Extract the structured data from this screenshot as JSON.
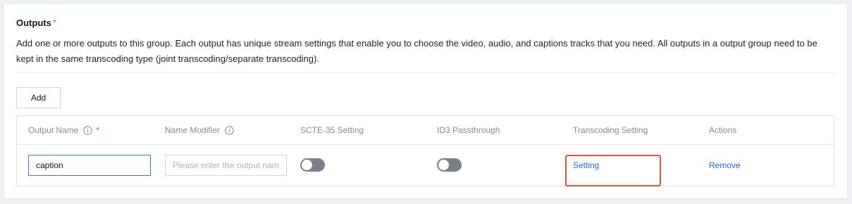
{
  "outputs": {
    "title": "Outputs",
    "required_marker": "*",
    "description": "Add one or more outputs to this group. Each output has unique stream settings that enable you to choose the video, audio, and captions tracks that you need. All outputs in a output group need to be kept in the same transcoding type (joint transcoding/separate transcoding).",
    "add_label": "Add"
  },
  "table": {
    "columns": {
      "output_name": "Output Name",
      "output_name_required": "*",
      "name_modifier": "Name Modifier",
      "scte35": "SCTE-35 Setting",
      "id3": "ID3 Passthrough",
      "transcoding": "Transcoding Setting",
      "actions": "Actions"
    },
    "rows": [
      {
        "output_name": "caption",
        "name_modifier_placeholder": "Please enter the output name modifier",
        "scte35_enabled": false,
        "id3_enabled": false,
        "transcoding_link": "Setting",
        "action_label": "Remove"
      }
    ]
  },
  "colors": {
    "accent": "#1c66e5",
    "required": "#e54545",
    "highlight": "#e0533a",
    "toggle_off": "#7a7f8c"
  },
  "icons": {
    "column_info": "info-circle-icon"
  }
}
